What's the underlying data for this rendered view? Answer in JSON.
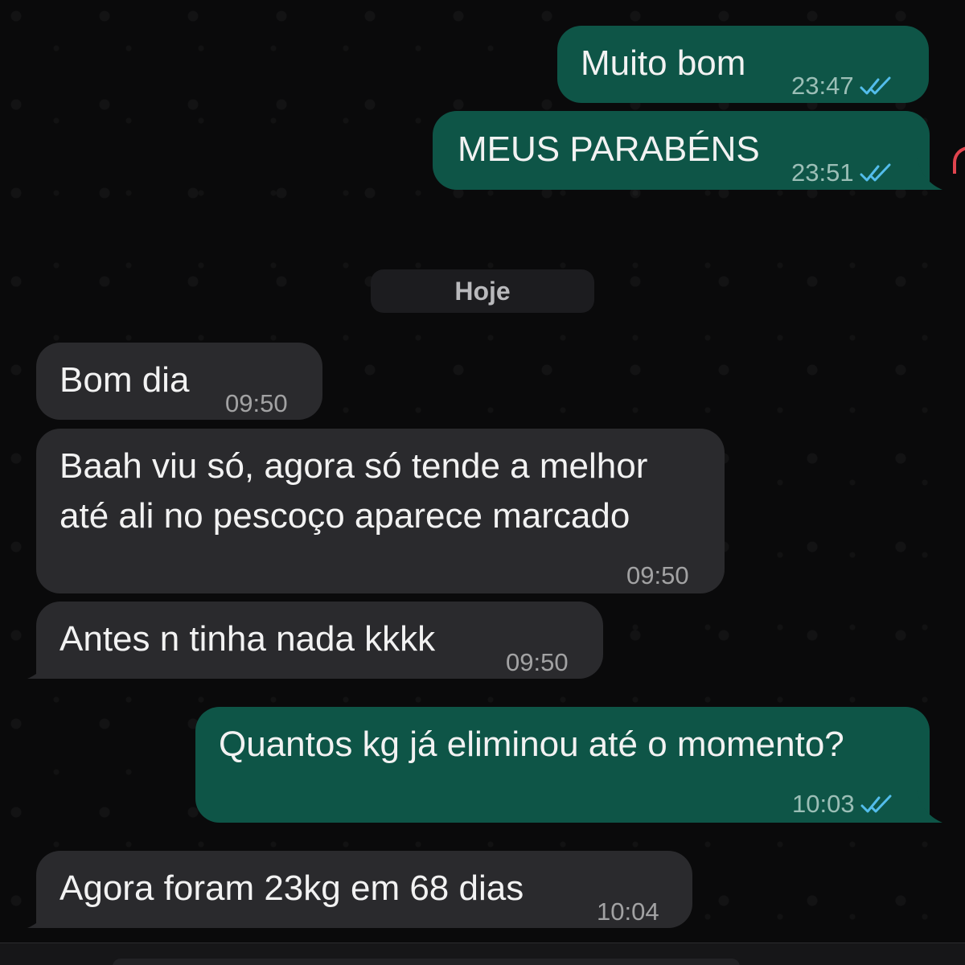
{
  "day_divider": "Hoje",
  "messages": [
    {
      "text": "Muito bom",
      "time": "23:47",
      "direction": "outgoing",
      "status": "read"
    },
    {
      "text": "MEUS PARABÉNS",
      "time": "23:51",
      "direction": "outgoing",
      "status": "read"
    },
    {
      "text": "Bom dia",
      "time": "09:50",
      "direction": "incoming"
    },
    {
      "line1": "Baah viu só, agora só tende a melhor",
      "line2": "até ali no pescoço aparece marcado",
      "time": "09:50",
      "direction": "incoming"
    },
    {
      "text": "Antes n tinha nada kkkk",
      "time": "09:50",
      "direction": "incoming"
    },
    {
      "text": "Quantos kg já eliminou até o momento?",
      "time": "10:03",
      "direction": "outgoing",
      "status": "read"
    },
    {
      "text": "Agora foram 23kg em 68 dias",
      "time": "10:04",
      "direction": "incoming"
    }
  ],
  "colors": {
    "outgoing_bubble": "#0e5547",
    "incoming_bubble": "#2a2a2d",
    "read_ticks": "#53bdeb",
    "background": "#0a0a0b"
  },
  "icons": {
    "read_receipt": "double-check-icon"
  }
}
